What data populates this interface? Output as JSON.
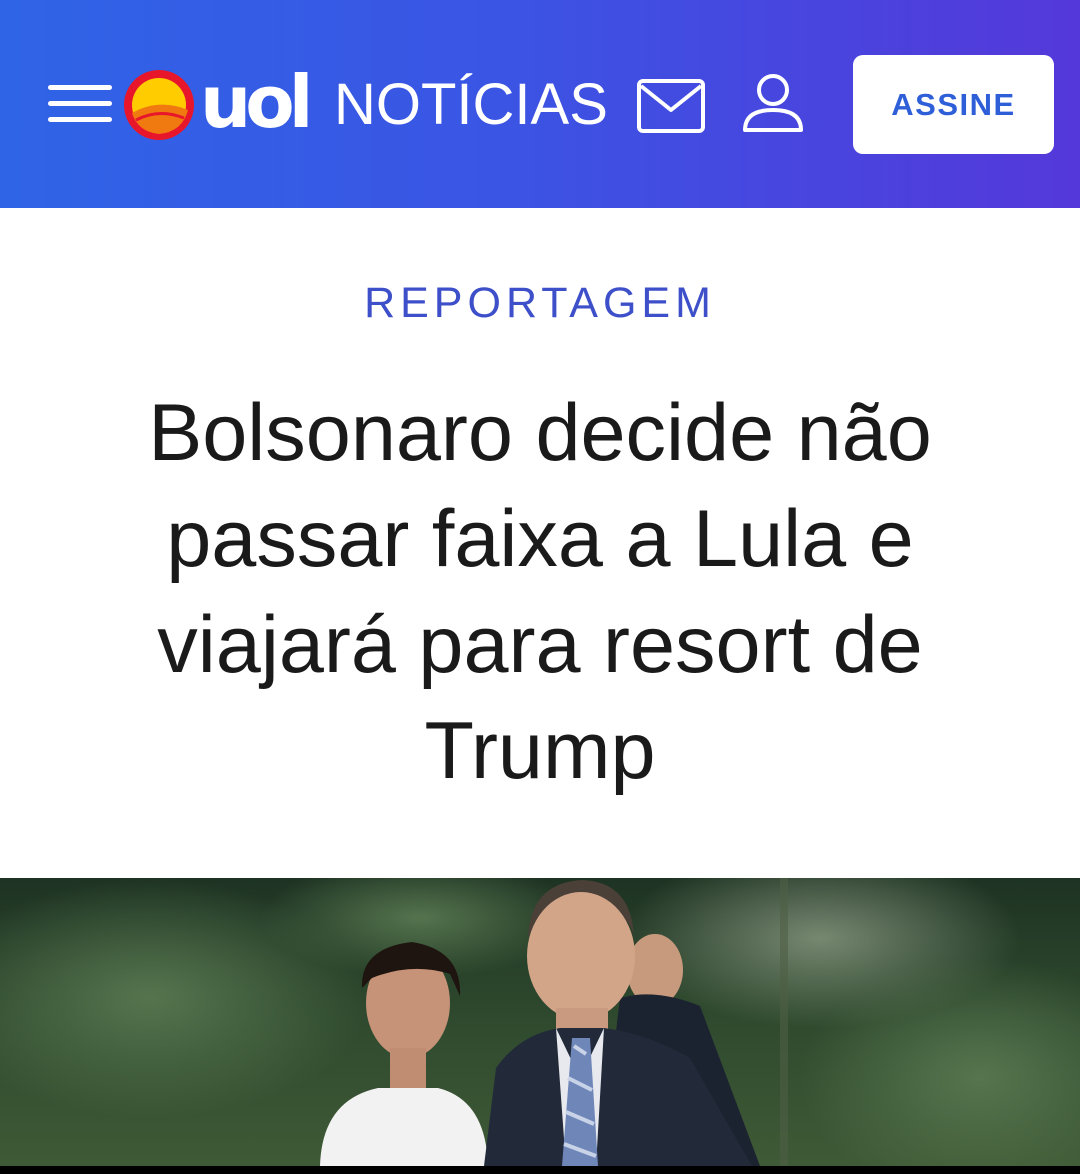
{
  "header": {
    "brand_logo_text": "uol",
    "section_name": "NOTÍCIAS",
    "subscribe_label": "ASSINE",
    "icons": {
      "menu": "hamburger-menu-icon",
      "logo": "uol-sun-logo-icon",
      "mail": "envelope-icon",
      "account": "user-icon"
    }
  },
  "article": {
    "kicker": "REPORTAGEM",
    "headline": "Bolsonaro decide não passar faixa a Lula e viajará para resort de Trump"
  },
  "photo": {
    "subject": "news-photo"
  },
  "colors": {
    "header_gradient_start": "#2f64e6",
    "header_gradient_end": "#5438da",
    "kicker": "#3d4fc9",
    "subscribe_text": "#2f5fd8",
    "headline": "#1a1a1a"
  }
}
